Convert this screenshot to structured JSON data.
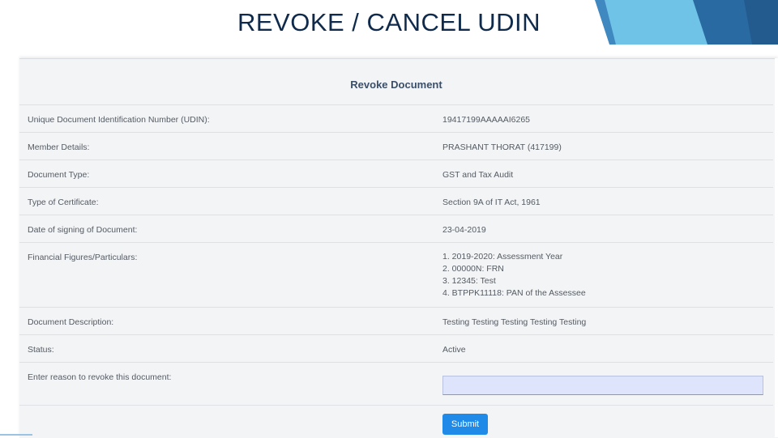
{
  "slide": {
    "title": "REVOKE / CANCEL UDIN"
  },
  "panel": {
    "heading": "Revoke Document"
  },
  "rows": [
    {
      "label": "Unique Document Identification Number (UDIN):",
      "value": "19417199AAAAAI6265"
    },
    {
      "label": "Member Details:",
      "value": "PRASHANT THORAT (417199)"
    },
    {
      "label": "Document Type:",
      "value": "GST and Tax Audit"
    },
    {
      "label": "Type of Certificate:",
      "value": "Section 9A of IT Act, 1961"
    },
    {
      "label": "Date of signing of Document:",
      "value": "23-04-2019"
    },
    {
      "label": "Financial Figures/Particulars:",
      "lines": [
        "1. 2019-2020: Assessment Year",
        "2. 00000N: FRN",
        "3. 12345: Test",
        "4. BTPPK11118: PAN of the Assessee"
      ]
    },
    {
      "label": "Document Description:",
      "value": "Testing Testing Testing Testing Testing"
    },
    {
      "label": "Status:",
      "value": "Active"
    }
  ],
  "revoke_reason": {
    "label": "Enter reason to revoke this document:",
    "value": "",
    "placeholder": ""
  },
  "submit": {
    "label": "Submit"
  },
  "colors": {
    "title": "#0f2a4a",
    "submit_button": "#1f8ae8",
    "input_background": "#dde4fb",
    "deco_dark_blue": "#2a6aa2",
    "deco_light_blue": "#6fc3e6"
  }
}
